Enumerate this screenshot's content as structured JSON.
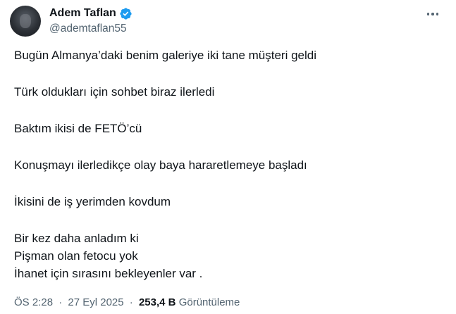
{
  "author": {
    "display_name": "Adem Taflan",
    "handle": "@ademtaflan55",
    "verified_color": "#1d9bf0",
    "avatar_icon": "avatar-photo"
  },
  "tweet": {
    "paragraphs": [
      [
        "Bugün Almanya’daki benim galeriye iki tane müşteri geldi"
      ],
      [
        "Türk oldukları için sohbet biraz ilerledi"
      ],
      [
        "Baktım ikisi de FETÖ’cü"
      ],
      [
        "Konuşmayı ilerledikçe olay baya hararetlemeye başladı"
      ],
      [
        "İkisini de iş yerimden kovdum"
      ],
      [
        "Bir kez daha anladım ki",
        "Pişman olan fetocu yok",
        "İhanet için sırasını bekleyenler var ."
      ]
    ]
  },
  "meta": {
    "time": "ÖS 2:28",
    "separator": "·",
    "date": "27 Eyl 2025",
    "views_count": "253,4 B",
    "views_label": "Görüntüleme"
  },
  "icons": {
    "more": "more-options-icon",
    "verified": "verified-badge-icon"
  }
}
